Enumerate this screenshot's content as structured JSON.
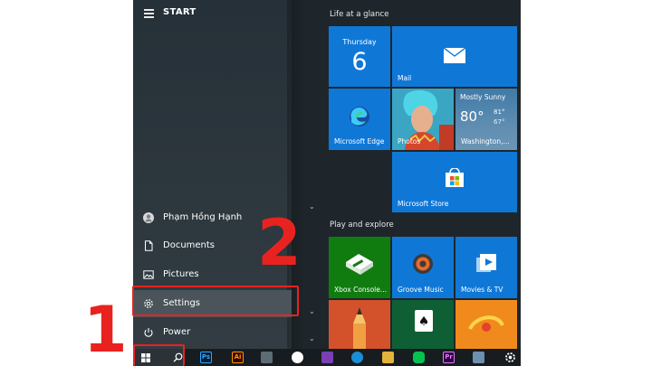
{
  "start": {
    "title": "START",
    "user_name": "Phạm Hồng Hạnh",
    "items": [
      "Documents",
      "Pictures",
      "Settings",
      "Power"
    ]
  },
  "groups": {
    "life": "Life at a glance",
    "play": "Play and explore"
  },
  "tiles": {
    "calendar_day": "Thursday",
    "calendar_date": "6",
    "mail": "Mail",
    "edge": "Microsoft Edge",
    "photos": "Photos",
    "weather_cond": "Mostly Sunny",
    "weather_temp": "80°",
    "weather_high": "81°",
    "weather_low": "67°",
    "weather_city": "Washington,...",
    "store": "Microsoft Store",
    "xbox": "Xbox Console...",
    "groove": "Groove Music",
    "movies": "Movies & TV"
  },
  "annotations": {
    "step1": "1",
    "step2": "2"
  },
  "colors": {
    "tile_blue": "#0f78d7",
    "tile_green": "#107c10",
    "annotation_red": "#e8231f"
  },
  "taskbar": {
    "ps_label": "Ps",
    "ai_label": "Ai",
    "pr_label": "Pr"
  }
}
